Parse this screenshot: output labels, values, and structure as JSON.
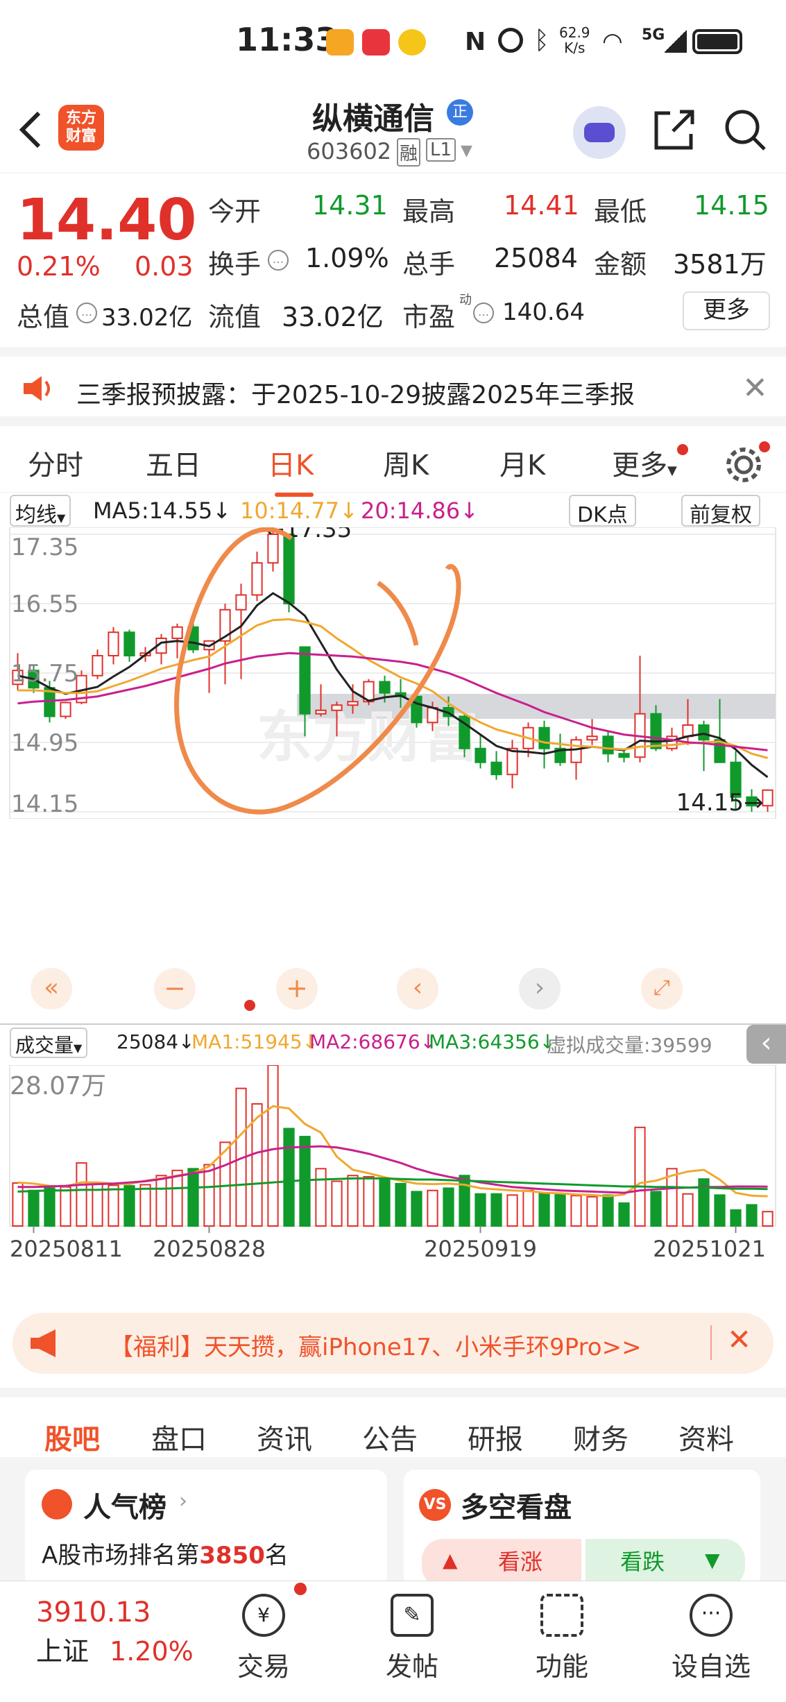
{
  "status_bar": {
    "time": "11:33",
    "net_speed_top": "62.9",
    "net_speed_unit": "K/s",
    "net_type": "5G"
  },
  "header": {
    "stock_name": "纵横通信",
    "badge": "正",
    "stock_code": "603602",
    "tag_margin": "融",
    "tag_level": "L1",
    "logo_line1": "东方",
    "logo_line2": "财富"
  },
  "quote": {
    "price": "14.40",
    "change_pct": "0.21%",
    "change_amt": "0.03",
    "open_label": "今开",
    "open": "14.31",
    "high_label": "最高",
    "high": "14.41",
    "low_label": "最低",
    "low": "14.15",
    "turnover_label": "换手",
    "turnover": "1.09%",
    "volume_label": "总手",
    "volume": "25084",
    "amount_label": "金额",
    "amount": "3581万",
    "mktcap_label": "总值",
    "mktcap": "33.02亿",
    "float_label": "流值",
    "float_cap": "33.02亿",
    "pe_label": "市盈",
    "pe_sup": "动",
    "pe": "140.64",
    "more_label": "更多"
  },
  "notice": {
    "text": "三季报预披露：于2025-10-29披露2025年三季报"
  },
  "tabs": [
    "分时",
    "五日",
    "日K",
    "周K",
    "月K",
    "更多"
  ],
  "active_tab": "日K",
  "kline_legend": {
    "selector": "均线",
    "ma5": "MA5:14.55↓",
    "ma10": "10:14.77↓",
    "ma20": "20:14.86↓",
    "dk": "DK点",
    "adjust": "前复权"
  },
  "volume_legend": {
    "selector": "成交量",
    "vol": "25084↓",
    "ma1": "MA1:51945↓",
    "ma2": "MA2:68676↓",
    "ma3": "MA3:64356↓",
    "virtual": "虚拟成交量:39599"
  },
  "colors": {
    "up": "#e0302a",
    "down": "#109a2c",
    "ma5": "#222222",
    "ma10": "#f0a830",
    "ma20": "#c8208c",
    "vol_ma3": "#109a2c",
    "annotation": "#ef8a4a"
  },
  "watermark": "东方财富",
  "chart_data": [
    {
      "type": "candlestick",
      "title": "",
      "y_ticks": [
        "17.35",
        "16.55",
        "15.75",
        "14.95",
        "14.15"
      ],
      "ylim": [
        14.15,
        17.35
      ],
      "max_label": "←17.35",
      "min_label": "14.15→",
      "x_ticks": [
        "20250811",
        "20250828",
        "20250919",
        "20251021"
      ],
      "candles": [
        [
          15.62,
          15.98,
          15.55,
          15.78
        ],
        [
          15.78,
          15.85,
          15.52,
          15.58
        ],
        [
          15.58,
          15.66,
          15.18,
          15.25
        ],
        [
          15.25,
          15.42,
          15.22,
          15.41
        ],
        [
          15.41,
          15.78,
          15.39,
          15.72
        ],
        [
          15.72,
          16.02,
          15.68,
          15.95
        ],
        [
          15.95,
          16.28,
          15.85,
          16.22
        ],
        [
          16.22,
          16.25,
          15.88,
          15.95
        ],
        [
          15.95,
          16.05,
          15.88,
          15.98
        ],
        [
          15.98,
          16.2,
          15.85,
          16.15
        ],
        [
          16.15,
          16.32,
          15.92,
          16.28
        ],
        [
          16.28,
          16.35,
          15.98,
          16.02
        ],
        [
          16.02,
          16.12,
          15.52,
          16.12
        ],
        [
          16.12,
          16.55,
          15.62,
          16.48
        ],
        [
          16.48,
          16.78,
          15.68,
          16.65
        ],
        [
          16.65,
          17.15,
          16.58,
          17.02
        ],
        [
          17.02,
          17.48,
          16.92,
          17.35
        ],
        [
          17.35,
          17.35,
          16.45,
          16.55
        ],
        [
          16.05,
          16.05,
          15.02,
          15.28
        ],
        [
          15.28,
          15.62,
          15.25,
          15.32
        ],
        [
          15.32,
          15.42,
          15.02,
          15.38
        ],
        [
          15.38,
          15.62,
          15.28,
          15.42
        ],
        [
          15.42,
          15.68,
          15.38,
          15.65
        ],
        [
          15.65,
          15.72,
          15.41,
          15.52
        ],
        [
          15.52,
          15.68,
          15.35,
          15.48
        ],
        [
          15.48,
          15.45,
          15.12,
          15.18
        ],
        [
          15.18,
          15.42,
          15.08,
          15.35
        ],
        [
          15.35,
          15.48,
          15.14,
          15.25
        ],
        [
          15.25,
          15.28,
          14.78,
          14.88
        ],
        [
          14.88,
          15.05,
          14.65,
          14.72
        ],
        [
          14.72,
          14.85,
          14.52,
          14.58
        ],
        [
          14.58,
          14.98,
          14.42,
          14.88
        ],
        [
          14.88,
          15.18,
          14.78,
          15.12
        ],
        [
          15.12,
          15.2,
          14.65,
          14.88
        ],
        [
          14.88,
          15.05,
          14.68,
          14.72
        ],
        [
          14.72,
          15.02,
          14.52,
          14.98
        ],
        [
          14.98,
          15.22,
          14.92,
          15.02
        ],
        [
          15.02,
          15.08,
          14.72,
          14.82
        ],
        [
          14.82,
          14.85,
          14.72,
          14.78
        ],
        [
          14.78,
          15.95,
          14.72,
          15.28
        ],
        [
          15.28,
          15.38,
          14.85,
          14.88
        ],
        [
          14.88,
          15.12,
          14.85,
          15.02
        ],
        [
          15.02,
          15.45,
          14.92,
          15.15
        ],
        [
          15.15,
          15.2,
          14.62,
          14.98
        ],
        [
          14.98,
          15.45,
          14.98,
          14.72
        ],
        [
          14.72,
          14.85,
          14.18,
          14.32
        ],
        [
          14.32,
          14.41,
          14.15,
          14.22
        ],
        [
          14.22,
          14.41,
          14.15,
          14.4
        ]
      ],
      "series": [
        {
          "name": "MA5",
          "values": [
            15.72,
            15.68,
            15.58,
            15.51,
            15.55,
            15.59,
            15.71,
            15.82,
            15.96,
            16.1,
            16.12,
            16.1,
            16.06,
            16.17,
            16.29,
            16.53,
            16.67,
            16.56,
            16.41,
            16.1,
            15.79,
            15.54,
            15.43,
            15.47,
            15.49,
            15.4,
            15.35,
            15.29,
            15.17,
            15.04,
            14.91,
            14.85,
            14.84,
            14.82,
            14.86,
            14.87,
            14.9,
            14.88,
            14.86,
            14.97,
            14.96,
            14.97,
            15.02,
            15.05,
            15.0,
            14.87,
            14.69,
            14.55
          ]
        },
        {
          "name": "MA10",
          "values": [
            15.55,
            15.55,
            15.54,
            15.52,
            15.52,
            15.54,
            15.6,
            15.66,
            15.73,
            15.8,
            15.85,
            15.9,
            15.94,
            16.06,
            16.18,
            16.3,
            16.36,
            16.37,
            16.34,
            16.29,
            16.15,
            16.03,
            15.9,
            15.8,
            15.7,
            15.63,
            15.54,
            15.4,
            15.28,
            15.18,
            15.1,
            15.05,
            15.0,
            14.95,
            14.93,
            14.91,
            14.9,
            14.88,
            14.87,
            14.9,
            14.91,
            14.92,
            14.94,
            14.95,
            14.96,
            14.91,
            14.82,
            14.77
          ]
        },
        {
          "name": "MA20",
          "values": [
            15.4,
            15.42,
            15.43,
            15.44,
            15.46,
            15.48,
            15.52,
            15.56,
            15.6,
            15.65,
            15.7,
            15.75,
            15.8,
            15.86,
            15.9,
            15.94,
            15.96,
            15.98,
            15.97,
            15.96,
            15.95,
            15.94,
            15.92,
            15.9,
            15.88,
            15.85,
            15.8,
            15.75,
            15.68,
            15.6,
            15.52,
            15.45,
            15.38,
            15.3,
            15.24,
            15.18,
            15.12,
            15.08,
            15.04,
            15.02,
            15.0,
            14.98,
            14.95,
            14.94,
            14.92,
            14.9,
            14.88,
            14.86
          ]
        }
      ]
    },
    {
      "type": "bar",
      "title": "",
      "y_ticks": [
        "28.07万"
      ],
      "ylim": [
        0,
        280700
      ],
      "values": [
        75000,
        62000,
        66000,
        68000,
        110000,
        74000,
        71000,
        70000,
        72000,
        88000,
        97000,
        100000,
        107000,
        146000,
        240000,
        213000,
        280700,
        170000,
        156000,
        100000,
        78000,
        88000,
        86000,
        82000,
        74000,
        60000,
        62000,
        66000,
        88000,
        56000,
        56000,
        54000,
        62000,
        58000,
        56000,
        53000,
        51000,
        54000,
        40000,
        172000,
        60000,
        100000,
        56000,
        82000,
        54000,
        28000,
        37000,
        25084
      ],
      "series": [
        {
          "name": "MA1",
          "values": [
            76000,
            74000,
            70000,
            69000,
            76000,
            76000,
            74000,
            73000,
            79000,
            83000,
            88000,
            92000,
            104000,
            131000,
            160000,
            189000,
            209000,
            205000,
            178000,
            163000,
            121000,
            98000,
            92000,
            85000,
            79000,
            74000,
            73000,
            74000,
            72000,
            66000,
            64000,
            62000,
            61000,
            58000,
            57000,
            55000,
            54000,
            52000,
            55000,
            75000,
            79000,
            88000,
            95000,
            98000,
            81000,
            58000,
            53000,
            51945
          ]
        },
        {
          "name": "MA2",
          "values": [
            68000,
            68000,
            69000,
            70000,
            72000,
            73000,
            74000,
            76000,
            78000,
            82000,
            87000,
            92000,
            96000,
            106000,
            118000,
            128000,
            134000,
            137000,
            138000,
            139000,
            137000,
            132000,
            126000,
            118000,
            110000,
            100000,
            92000,
            86000,
            81000,
            76000,
            72000,
            68000,
            66000,
            64000,
            62000,
            61000,
            60000,
            59000,
            58000,
            62000,
            64000,
            66000,
            67000,
            68000,
            68000,
            69000,
            69000,
            68676
          ]
        },
        {
          "name": "MA3",
          "values": [
            60000,
            61000,
            62000,
            62000,
            63000,
            63000,
            64000,
            64000,
            65000,
            65000,
            66000,
            67000,
            68000,
            70000,
            72000,
            74000,
            76000,
            78000,
            80000,
            81000,
            82000,
            83000,
            83000,
            83000,
            82000,
            81000,
            81000,
            80000,
            79000,
            78000,
            77000,
            76000,
            75000,
            74000,
            73000,
            72000,
            71000,
            70000,
            69000,
            69000,
            68000,
            68000,
            67000,
            67000,
            66000,
            65000,
            65000,
            64356
          ]
        }
      ]
    }
  ],
  "chart_controls": {
    "zoom_out": "−",
    "zoom_in": "+"
  },
  "promo": {
    "text": "【福利】天天攒，赢iPhone17、小米手环9Pro>>"
  },
  "bottom_tabs": [
    "股吧",
    "盘口",
    "资讯",
    "公告",
    "研报",
    "财务",
    "资料"
  ],
  "active_bottom_tab": "股吧",
  "cards": {
    "popularity_title": "人气榜",
    "popularity_text_prefix": "A股市场排名第",
    "popularity_rank": "3850",
    "popularity_text_suffix": "名",
    "bullbear_title": "多空看盘",
    "bull": "看涨",
    "bear": "看跌"
  },
  "bottom_bar": {
    "index_value": "3910.13",
    "index_name": "上证",
    "index_change": "1.20%",
    "trade": "交易",
    "post": "发帖",
    "function": "功能",
    "watchlist": "设自选"
  }
}
